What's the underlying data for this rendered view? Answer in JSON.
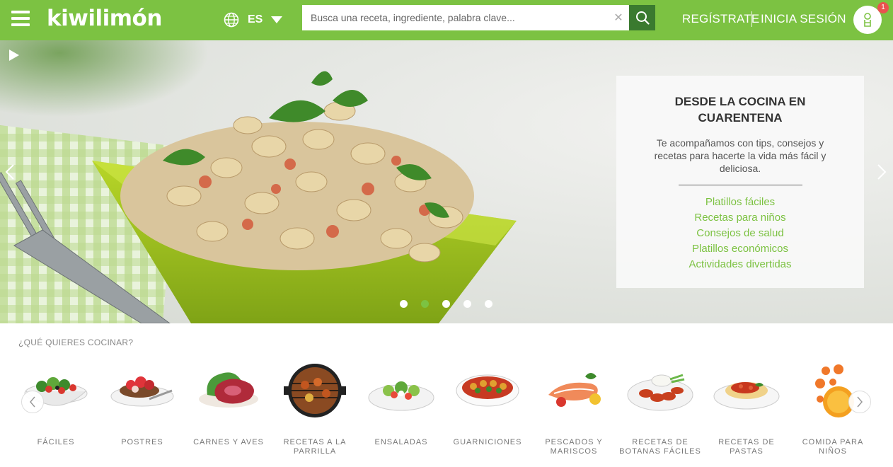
{
  "header": {
    "logo_text": "kiwilimón",
    "language": "ES",
    "search_placeholder": "Busca una receta, ingrediente, palabra clave...",
    "register_label": "REGÍSTRATE",
    "login_label": "INICIA SESIÓN",
    "notification_count": "1",
    "brand_color": "#7cc242"
  },
  "hero": {
    "title": "DESDE LA COCINA EN CUARENTENA",
    "description": "Te acompañamos con tips, consejos y recetas para hacerte la vida más fácil y deliciosa.",
    "links": [
      "Platillos fáciles",
      "Recetas para niños",
      "Consejos de salud",
      "Platillos económicos",
      "Actividades divertidas"
    ],
    "slide_count": 5,
    "active_slide": 2
  },
  "categories": {
    "title": "¿QUÉ QUIERES COCINAR?",
    "items": [
      {
        "label": "FÁCILES",
        "icon": "salad-bowl-icon"
      },
      {
        "label": "POSTRES",
        "icon": "dessert-plate-icon"
      },
      {
        "label": "CARNES Y AVES",
        "icon": "meat-icon"
      },
      {
        "label": "RECETAS A LA PARRILLA",
        "icon": "grill-icon"
      },
      {
        "label": "ENSALADAS",
        "icon": "salad-plate-icon"
      },
      {
        "label": "GUARNICIONES",
        "icon": "casserole-icon"
      },
      {
        "label": "PESCADOS Y MARISCOS",
        "icon": "fish-icon"
      },
      {
        "label": "RECETAS DE BOTANAS FÁCILES",
        "icon": "wings-icon"
      },
      {
        "label": "RECETAS DE PASTAS",
        "icon": "pasta-icon"
      },
      {
        "label": "COMIDA PARA NIÑOS",
        "icon": "kids-food-icon"
      }
    ]
  }
}
